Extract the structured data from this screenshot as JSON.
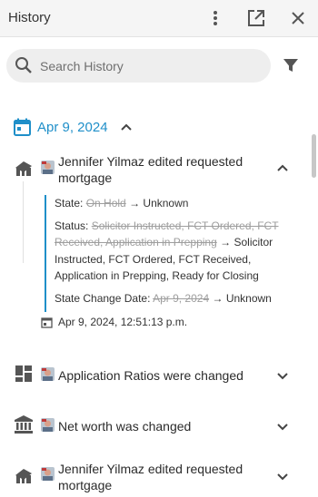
{
  "header": {
    "title": "History"
  },
  "search": {
    "placeholder": "Search History"
  },
  "date_group": {
    "label": "Apr 9, 2024"
  },
  "entries": [
    {
      "title": "Jennifer Yilmaz edited requested mortgage",
      "icon": "mortgage-icon",
      "expanded": true,
      "details": [
        {
          "label": "State: ",
          "old": "On Hold",
          "new": "Unknown"
        },
        {
          "label": "Status: ",
          "old": "Solicitor Instructed, FCT Ordered, FCT Received, Application in Prepping",
          "new": "Solicitor Instructed, FCT Ordered, FCT Received, Application in Prepping, Ready for Closing"
        },
        {
          "label": "State Change Date: ",
          "old": "Apr 9, 2024",
          "new": "Unknown"
        }
      ],
      "timestamp": "Apr 9, 2024, 12:51:13 p.m."
    },
    {
      "title": "Application Ratios were changed",
      "icon": "dashboard-icon",
      "expanded": false
    },
    {
      "title": "Net worth was changed",
      "icon": "bank-icon",
      "expanded": false
    },
    {
      "title": "Jennifer Yilmaz edited requested mortgage",
      "icon": "mortgage-icon",
      "expanded": false
    }
  ],
  "arrow": "→",
  "colors": {
    "accent": "#1f8fc9",
    "icon": "#555555"
  }
}
